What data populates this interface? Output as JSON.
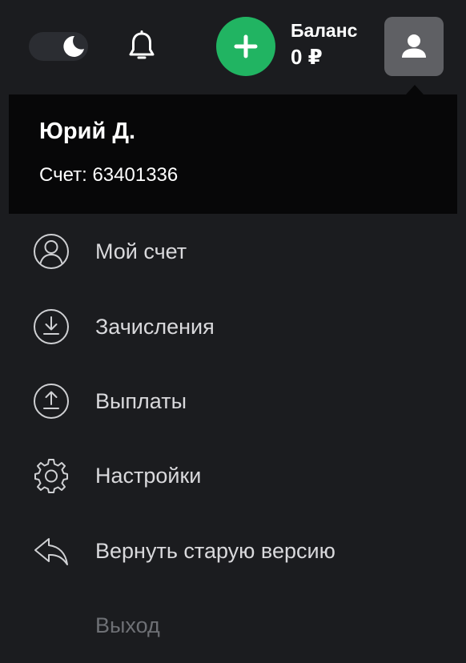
{
  "header": {
    "balance_label": "Баланс",
    "balance_value": "0 ₽",
    "theme_icon": "moon-icon",
    "notification_icon": "bell-icon",
    "add_icon": "plus-icon",
    "profile_icon": "user-icon"
  },
  "profile": {
    "name": "Юрий Д.",
    "account_label": "Счет:",
    "account_number": "63401336"
  },
  "menu": {
    "items": [
      {
        "label": "Мой счет",
        "icon": "user-circle-icon"
      },
      {
        "label": "Зачисления",
        "icon": "download-circle-icon"
      },
      {
        "label": "Выплаты",
        "icon": "upload-circle-icon"
      },
      {
        "label": "Настройки",
        "icon": "gear-icon"
      },
      {
        "label": "Вернуть старую версию",
        "icon": "reply-arrow-icon"
      },
      {
        "label": "Выход"
      }
    ]
  },
  "colors": {
    "background": "#1b1c1f",
    "accent_green": "#21b462",
    "menu_header_bg": "#070708",
    "avatar_bg": "#5f6064"
  }
}
